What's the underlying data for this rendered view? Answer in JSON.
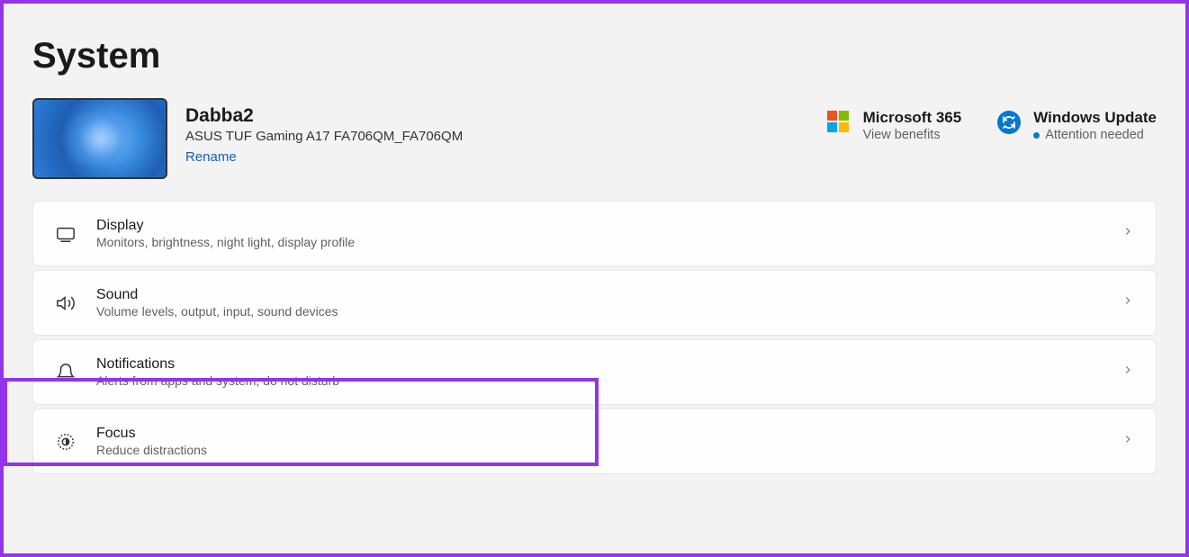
{
  "pageTitle": "System",
  "device": {
    "name": "Dabba2",
    "model": "ASUS TUF Gaming A17 FA706QM_FA706QM",
    "renameLabel": "Rename"
  },
  "statusCards": {
    "ms365": {
      "title": "Microsoft 365",
      "sub": "View benefits"
    },
    "windowsUpdate": {
      "title": "Windows Update",
      "sub": "Attention needed"
    }
  },
  "settings": [
    {
      "id": "display",
      "icon": "display-icon",
      "title": "Display",
      "desc": "Monitors, brightness, night light, display profile"
    },
    {
      "id": "sound",
      "icon": "sound-icon",
      "title": "Sound",
      "desc": "Volume levels, output, input, sound devices"
    },
    {
      "id": "notifications",
      "icon": "bell-icon",
      "title": "Notifications",
      "desc": "Alerts from apps and system, do not disturb"
    },
    {
      "id": "focus",
      "icon": "focus-icon",
      "title": "Focus",
      "desc": "Reduce distractions"
    }
  ]
}
